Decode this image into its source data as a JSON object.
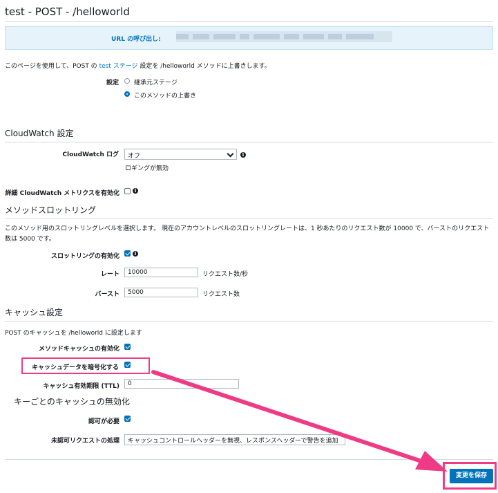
{
  "page": {
    "title": "test - POST - /helloworld",
    "url_label": "URL の呼び出し:",
    "desc_pre": "このページを使用して、POST の ",
    "desc_link": "test ステージ",
    "desc_post": " 設定を /helloworld メソッドに上書きします。",
    "settings_label": "設定",
    "radio_inherit": "継承元ステージ",
    "radio_override": "このメソッドの上書き"
  },
  "cloudwatch": {
    "heading": "CloudWatch 設定",
    "log_label": "CloudWatch ログ",
    "log_value": "オフ",
    "log_help": "ロギングが無効",
    "metrics_label": "詳細 CloudWatch メトリクスを有効化"
  },
  "throttling": {
    "heading": "メソッドスロットリング",
    "desc_line1": "このメソッド用のスロットリングレベルを選択します。 現在のアカウントレベルのスロットリングレートは、1 秒あたりのリクエスト数が 10000 で、バーストのリクエスト",
    "desc_line2": "数は 5000 です。",
    "enable_label": "スロットリングの有効化",
    "rate_label": "レート",
    "rate_value": "10000",
    "rate_unit": "リクエスト数/秒",
    "burst_label": "バースト",
    "burst_value": "5000",
    "burst_unit": "リクエスト数"
  },
  "cache": {
    "heading": "キャッシュ設定",
    "desc": "POST のキャッシュを /helloworld に設定します",
    "enable_label": "メソッドキャッシュの有効化",
    "encrypt_label": "キャッシュデータを暗号化する",
    "ttl_label": "キャッシュ有効期限 (TTL)",
    "ttl_value": "0",
    "invalidation_heading": "キーごとのキャッシュの無効化",
    "auth_label": "認可が必要",
    "unauth_label": "未認可リクエストの処理",
    "unauth_value": "キャッシュコントロールヘッダーを無視、レスポンスヘッダーで警告を追加"
  },
  "actions": {
    "save_label": "変更を保存"
  },
  "colors": {
    "accent": "#0073bb",
    "highlight": "#ef3b86"
  },
  "icons": [
    "info-icon",
    "chevron-down-icon",
    "checkbox-icon",
    "radio-icon"
  ]
}
